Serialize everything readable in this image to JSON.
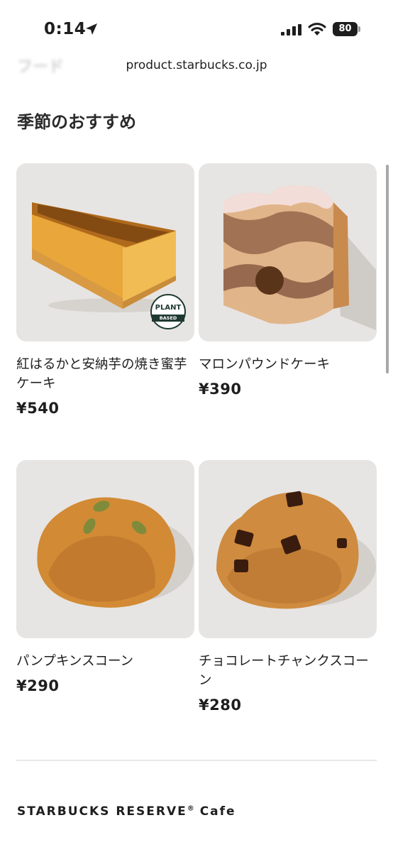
{
  "status_bar": {
    "time": "0:14",
    "battery": "80",
    "icons": [
      "location-arrow-icon",
      "cellular-signal-icon",
      "wifi-icon",
      "battery-icon"
    ]
  },
  "browser": {
    "faded_title": "フード",
    "url": "product.starbucks.co.jp"
  },
  "section": {
    "title": "季節のおすすめ"
  },
  "products": [
    {
      "name": "紅はるかと安納芋の焼き蜜芋ケーキ",
      "price": "¥540",
      "badge": {
        "top": "PLANT",
        "bottom": "BASED"
      }
    },
    {
      "name": "マロンパウンドケーキ",
      "price": "¥390"
    },
    {
      "name": "パンプキンスコーン",
      "price": "¥290"
    },
    {
      "name": "チョコレートチャンクスコーン",
      "price": "¥280"
    }
  ],
  "footer": {
    "brand": "STARBUCKS RESERVE",
    "registered_mark": "®",
    "suffix": "Cafe"
  },
  "colors": {
    "card_background": "#e7e5e3",
    "text": "#1e1e1e",
    "badge_green": "#1e3932"
  }
}
